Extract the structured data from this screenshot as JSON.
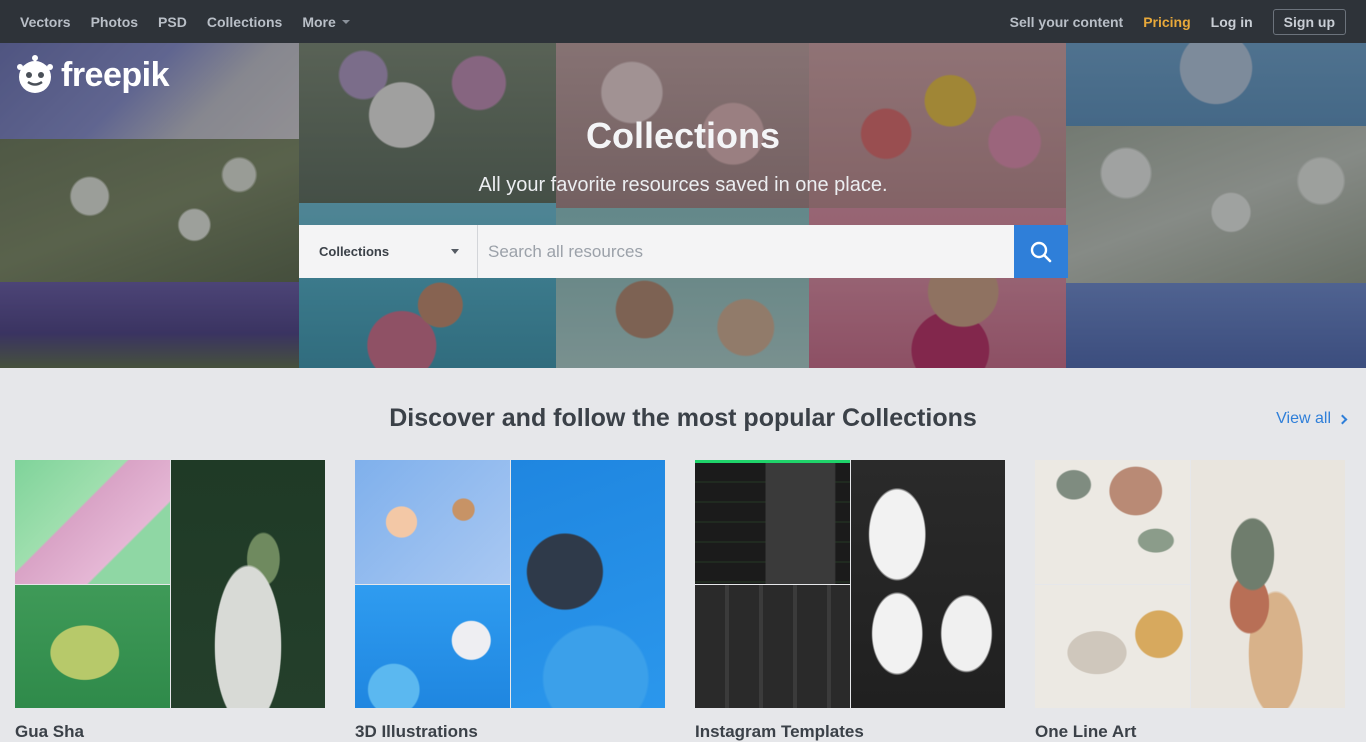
{
  "nav": {
    "left": [
      "Vectors",
      "Photos",
      "PSD",
      "Collections",
      "More"
    ],
    "sell": "Sell your content",
    "pricing": "Pricing",
    "login": "Log in",
    "signup": "Sign up"
  },
  "brand": {
    "logo_text": "freepik"
  },
  "hero": {
    "title": "Collections",
    "subtitle": "All your favorite resources saved in one place.",
    "search": {
      "category": "Collections",
      "placeholder": "Search all resources"
    }
  },
  "discover": {
    "title": "Discover and follow the most popular Collections",
    "view_all": "View all"
  },
  "collections": [
    {
      "name": "Gua Sha"
    },
    {
      "name": "3D Illustrations"
    },
    {
      "name": "Instagram Templates"
    },
    {
      "name": "One Line Art"
    }
  ],
  "colors": {
    "nav_bg": "#2e3339",
    "accent_blue": "#2f7fd9",
    "pricing_orange": "#e8a93a",
    "page_bg": "#e6e7ea"
  }
}
